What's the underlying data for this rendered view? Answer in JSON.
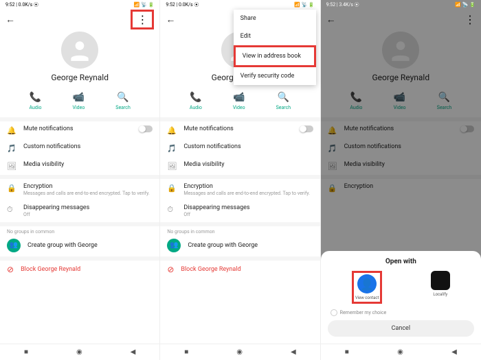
{
  "status": {
    "time1": "9:52 | 0.0K/s ⦿",
    "time3": "9:52 | 3.4K/s ⦿",
    "right": "📶 📡 🔋"
  },
  "contact": {
    "name": "George Reynald"
  },
  "actions": {
    "audio": "Audio",
    "video": "Video",
    "search": "Search"
  },
  "items": {
    "mute": "Mute notifications",
    "custom": "Custom notifications",
    "media": "Media visibility",
    "encryption": "Encryption",
    "encryption_sub": "Messages and calls are end-to-end encrypted. Tap to verify.",
    "disappear": "Disappearing messages",
    "disappear_sub": "Off"
  },
  "groups": {
    "label": "No groups in common",
    "create": "Create group with George"
  },
  "block": "Block George Reynald",
  "menu": {
    "share": "Share",
    "edit": "Edit",
    "view": "View in address book",
    "verify": "Verify security code"
  },
  "sheet": {
    "title": "Open with",
    "app1": "View contact",
    "app2": "Localify",
    "remember": "Remember my choice",
    "cancel": "Cancel"
  }
}
